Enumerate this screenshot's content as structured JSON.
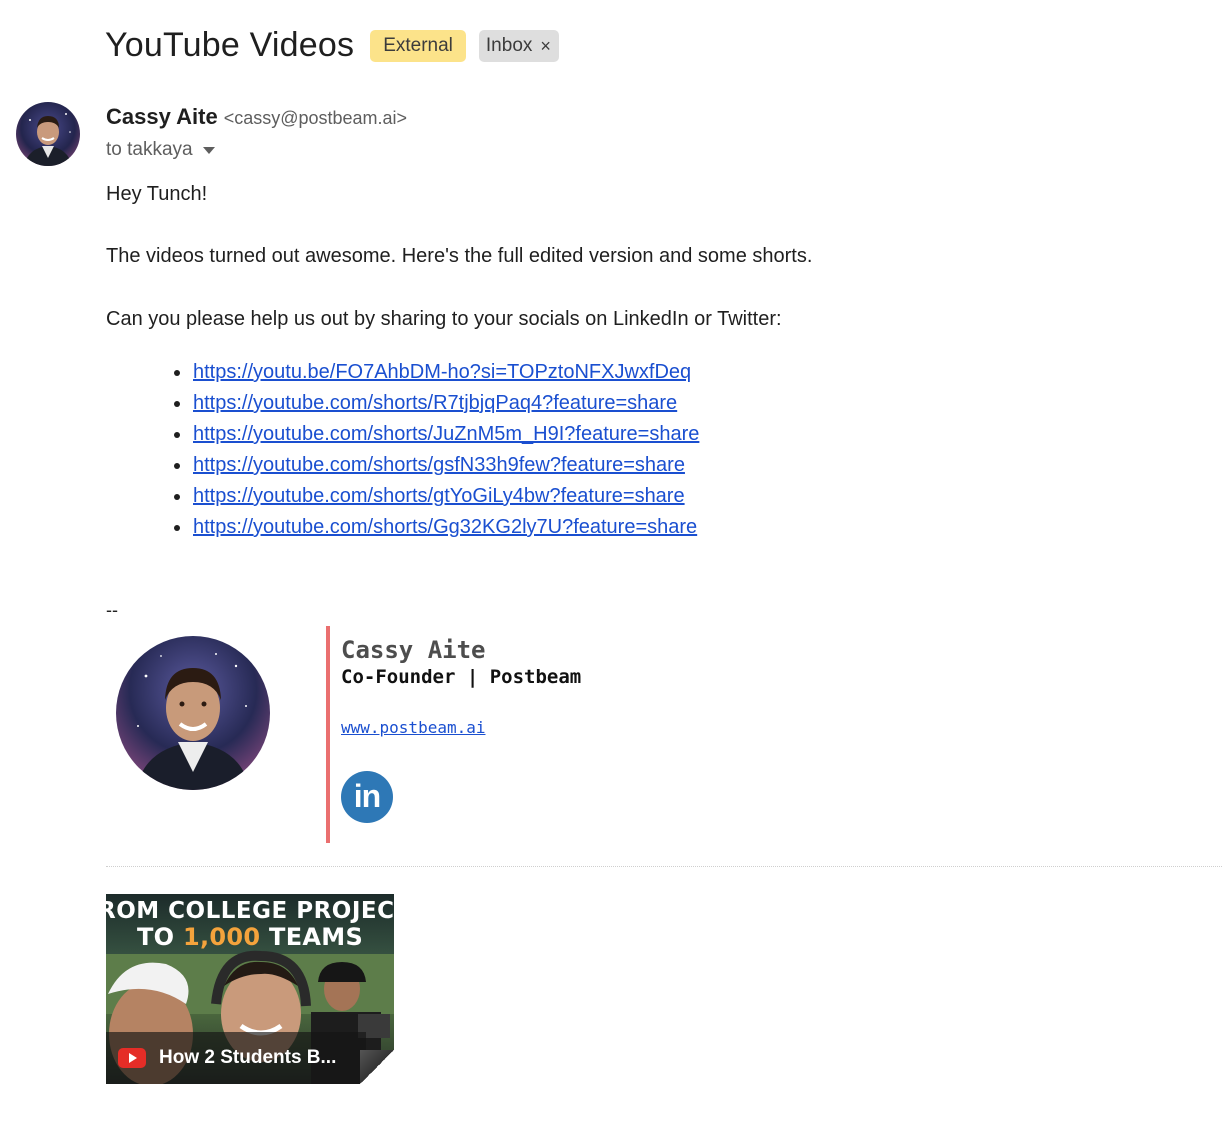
{
  "email": {
    "subject": "YouTube Videos",
    "labels": {
      "external": "External",
      "inbox": "Inbox",
      "remove_icon": "×"
    },
    "sender": {
      "name": "Cassy Aite",
      "email": "<cassy@postbeam.ai>",
      "to": "to takkaya"
    },
    "body": {
      "greeting": "Hey Tunch!",
      "line1": "The videos turned out awesome. Here's the full edited version and some shorts.",
      "line2": "Can you please help us out by sharing to your socials on LinkedIn or Twitter:",
      "links": [
        "https://youtu.be/FO7AhbDM-ho?si=TOPztoNFXJwxfDeq",
        "https://youtube.com/shorts/R7tjbjqPaq4?feature=share",
        "https://youtube.com/shorts/JuZnM5m_H9I?feature=share",
        "https://youtube.com/shorts/gsfN33h9few?feature=share",
        "https://youtube.com/shorts/gtYoGiLy4bw?feature=share",
        "https://youtube.com/shorts/Gg32KG2ly7U?feature=share"
      ]
    },
    "signature": {
      "dash": "--",
      "name": "Cassy Aite",
      "role": "Co-Founder | Postbeam",
      "website": "www.postbeam.ai",
      "linkedin_glyph": "in",
      "accent_color": "#ea6f6f"
    },
    "attachment": {
      "headline_line1": "ROM COLLEGE PROJEC",
      "headline_line2_prefix": "TO ",
      "headline_line2_highlight": "1,000",
      "headline_line2_suffix": " TEAMS",
      "title": "How 2 Students B..."
    }
  }
}
